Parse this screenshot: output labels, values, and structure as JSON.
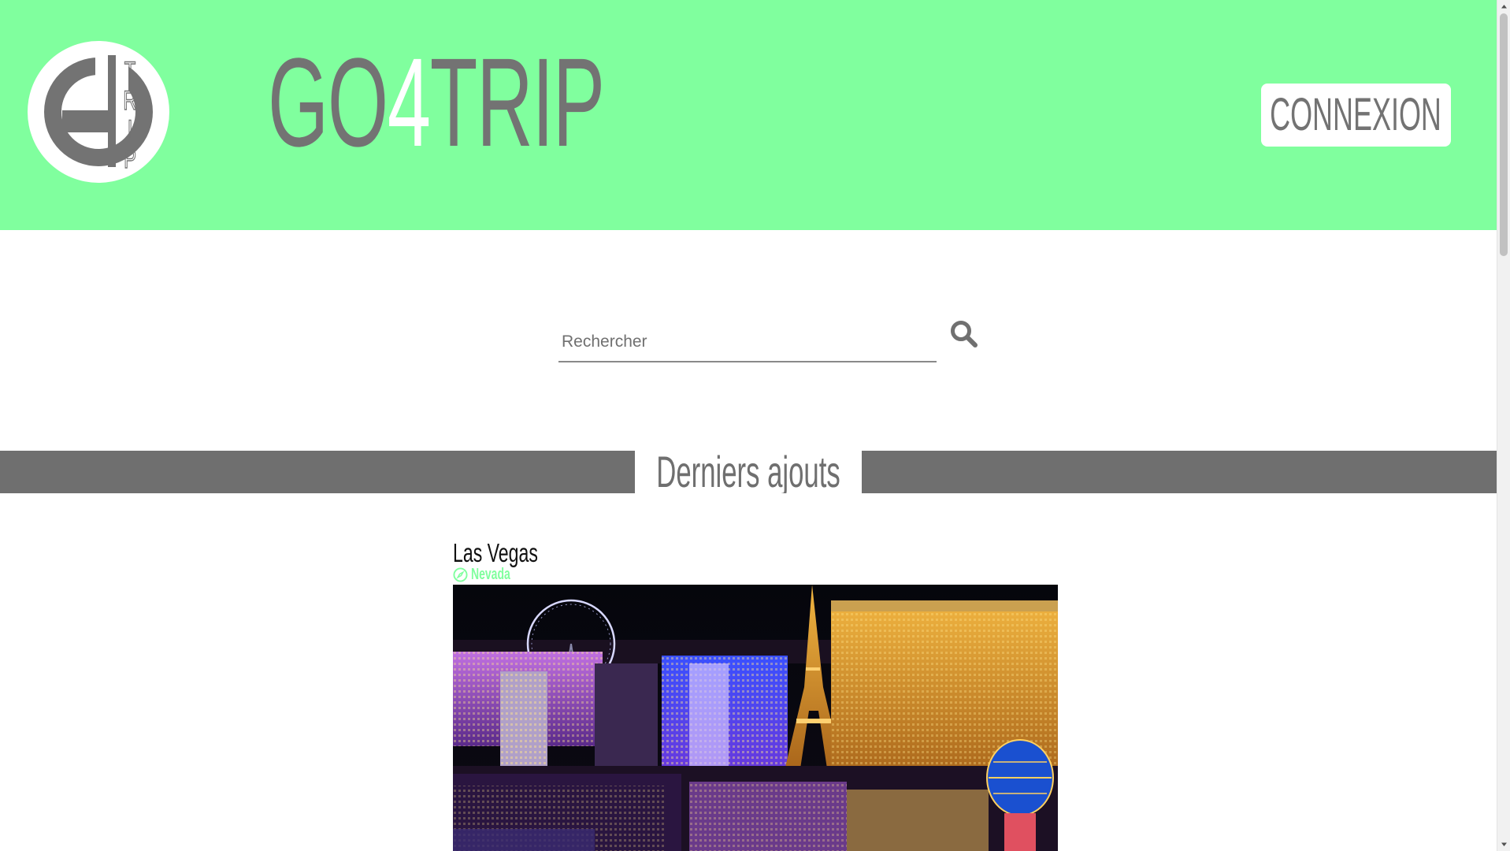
{
  "site": {
    "title_part1": "GO",
    "title_part2": "4",
    "title_part3": "TRIP",
    "logo_letters": [
      "T",
      "R",
      "I",
      "P"
    ]
  },
  "header": {
    "login_label": "CONNEXION"
  },
  "search": {
    "placeholder": "Rechercher",
    "value": ""
  },
  "section": {
    "title": "Derniers ajouts"
  },
  "cards": [
    {
      "title": "Las Vegas",
      "location": "Nevada"
    }
  ],
  "colors": {
    "header_bg": "#80ff9e",
    "accent": "#80ff9e",
    "text_gray": "#737373",
    "band_gray": "#6f6f6f"
  },
  "icons": {
    "search": "search-icon",
    "location": "compass-icon"
  }
}
